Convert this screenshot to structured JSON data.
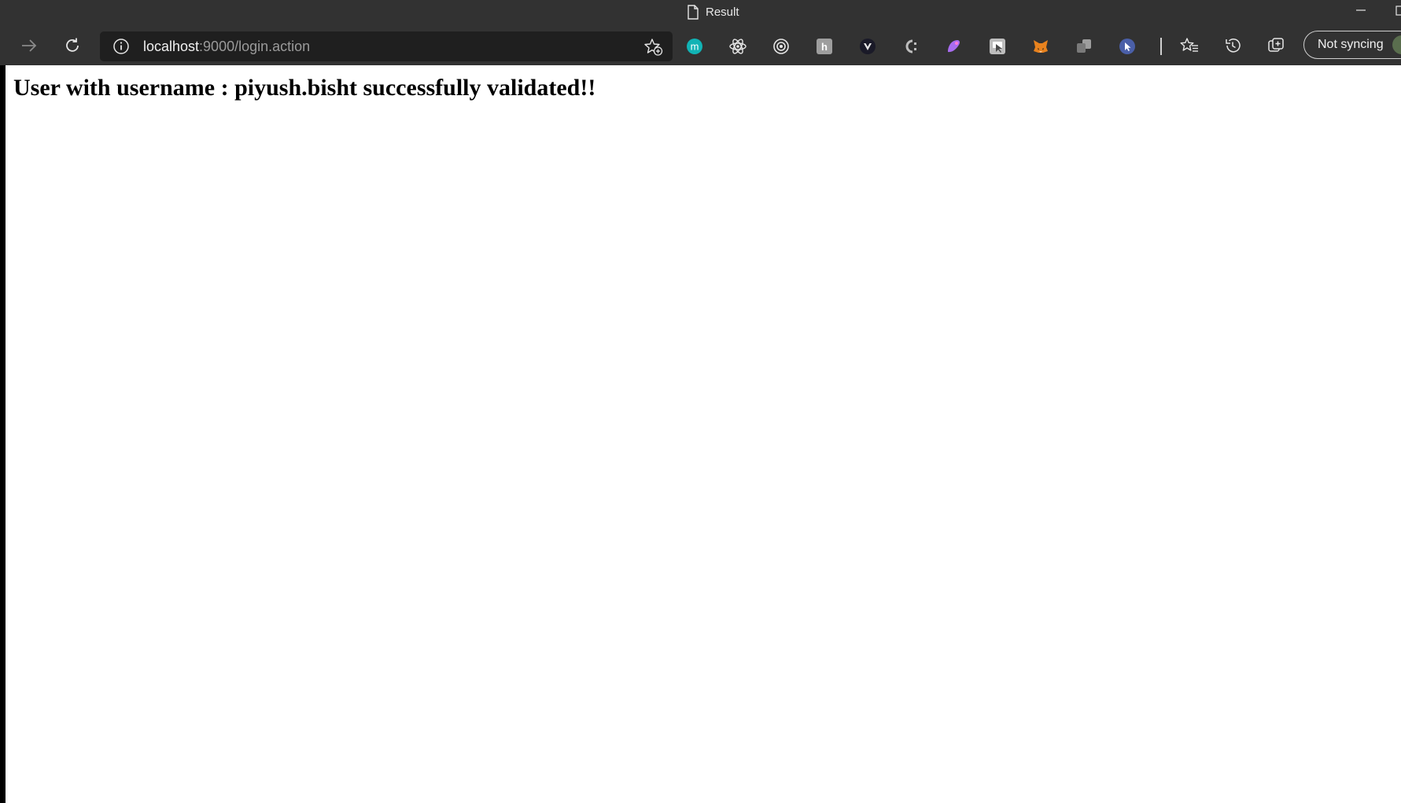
{
  "window": {
    "title": "Result"
  },
  "toolbar": {
    "back_icon": "arrow-right-icon",
    "refresh_icon": "refresh-icon",
    "address": {
      "host": "localhost",
      "rest": ":9000/login.action"
    },
    "extensions": [
      {
        "name": "m-extension",
        "letter": "m",
        "color": "#11b3b5"
      },
      {
        "name": "react-devtools",
        "color": "#e6e6e6"
      },
      {
        "name": "target-extension",
        "color": "#e6e6e6"
      },
      {
        "name": "h-extension",
        "color": "#9e9e9e"
      },
      {
        "name": "vuetify-extension",
        "color": "#1f1f2e"
      },
      {
        "name": "c-extension",
        "color": "#bdbdbd"
      },
      {
        "name": "purple-extension",
        "color": "#a86cf0"
      },
      {
        "name": "pointer-extension",
        "color": "#bdbdbd"
      },
      {
        "name": "metamask-fox",
        "color": "#e8821e"
      },
      {
        "name": "copies-extension",
        "color": "#9e9e9e"
      },
      {
        "name": "cursor-extension",
        "color": "#4a5fa8"
      }
    ],
    "sync_label": "Not syncing"
  },
  "page": {
    "message": "User with username : piyush.bisht successfully validated!!"
  }
}
